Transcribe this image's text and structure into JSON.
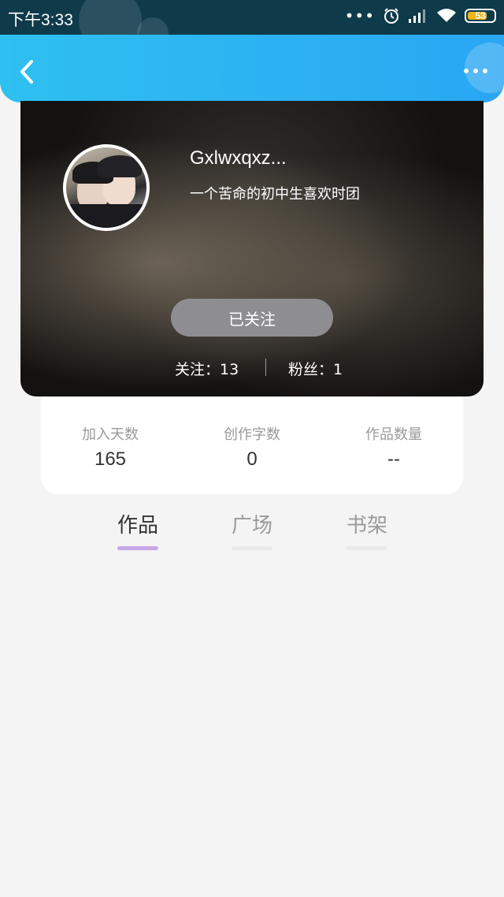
{
  "status_bar": {
    "time": "下午3:33",
    "battery": "53"
  },
  "header": {
    "back_icon": "chevron-left-icon",
    "more_icon": "more-dots-icon"
  },
  "profile": {
    "username": "Gxlwxqxz...",
    "bio": "一个苦命的初中生喜欢时团",
    "follow_button": "已关注",
    "following": "关注：13",
    "fans": "粉丝：1"
  },
  "stats": [
    {
      "label": "加入天数",
      "value": "165"
    },
    {
      "label": "创作字数",
      "value": "0"
    },
    {
      "label": "作品数量",
      "value": "--"
    }
  ],
  "tabs": [
    {
      "label": "作品",
      "active": true
    },
    {
      "label": "广场",
      "active": false
    },
    {
      "label": "书架",
      "active": false
    }
  ],
  "colors": {
    "header_gradient_start": "#2ec0f0",
    "header_gradient_end": "#2aa6f3",
    "active_tab_underline": "#c7a6e6",
    "follow_button": "#8e8d92",
    "battery_fill": "#f3b417"
  }
}
